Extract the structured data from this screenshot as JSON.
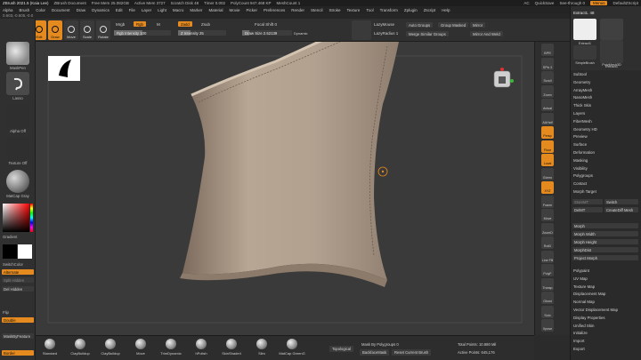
{
  "titlebar": {
    "title": "ZBrush 2021.5 (Kaia Lee)",
    "doc": "ZBrush Document",
    "free_mem": "Free Mem 25.082GB",
    "active_mem": "Active Mem 3727",
    "scratch": "Scratch Disk 48",
    "timer": "Timer 0.002",
    "polycount": "PolyCount 947.468 KP",
    "meshcount": "MeshCount 1",
    "right": [
      "AC",
      "QuickSave",
      "See-through 0",
      "Menus",
      "DefaultZScript"
    ]
  },
  "menubar": [
    "Alpha",
    "Brush",
    "Color",
    "Document",
    "Draw",
    "Dynamics",
    "Edit",
    "File",
    "Layer",
    "Light",
    "Macro",
    "Marker",
    "Material",
    "Movie",
    "Picker",
    "Preferences",
    "Render",
    "Stencil",
    "Stroke",
    "Texture",
    "Tool",
    "Transform",
    "Zplugin",
    "Zscript",
    "Help"
  ],
  "status": "0.603,-0.605,-0.0",
  "topshelf": {
    "lightbox": "LightBox",
    "tools": [
      {
        "label": "Edit",
        "active": true
      },
      {
        "label": "Draw",
        "active": true
      },
      {
        "label": "Move",
        "active": false
      },
      {
        "label": "Scale",
        "active": false
      },
      {
        "label": "Rotate",
        "active": false
      }
    ],
    "mrgb": "Mrgb",
    "rgb": "Rgb",
    "m": "M",
    "rgb_intensity": "Rgb Intensity 100",
    "zadd": "Zadd",
    "zsub": "Zsub",
    "z_intensity": "Z Intensity 25",
    "focal_shift": "Focal Shift 0",
    "draw_size": "Draw Size 2.52139",
    "dynamic": "Dynamic",
    "lazymouse": "LazyMouse",
    "lazyradius": "LazyRadius 1",
    "auto_groups": "Auto Groups",
    "group_masked": "Group Masked",
    "mirror": "Mirror",
    "merge_similar": "Merge Similar Groups",
    "mirror_weld": "Mirror And Weld",
    "rgb_pct": 0.5,
    "z_pct": 0.25,
    "draw_pct": 0.15
  },
  "leftpanel": {
    "brush": "MaskPen",
    "stroke": "Lasso",
    "alpha": "Alpha Off",
    "texture": "Texture Off",
    "material": "MatCap Gray",
    "gradient": "Gradient",
    "switch": "SwitchColor",
    "alternate": "Alternate",
    "split_hidden": "Split Hidden",
    "del_hidden": "Del Hidden",
    "flip": "Flip",
    "double": "Double",
    "mask_by_feature": "MaskByFeature",
    "border": "Border"
  },
  "rightdock": [
    "BPR",
    "SPix 3",
    "Scroll",
    "Zoom",
    "Actual",
    "AAHalf",
    "Persp",
    "Floor",
    "Local",
    "Gizmo",
    "XYZ",
    "Frame",
    "Move",
    "ZoomD",
    "RotD",
    "Line Fill",
    "PolyF",
    "Transp",
    "Ghost",
    "Solo",
    "Xpose"
  ],
  "toolpanel": {
    "header": "Extract1. 48",
    "thumbs": [
      "Extract1",
      "Cylinder3D",
      "PolyMesh3D",
      "SimpleBrush",
      "Extract1"
    ],
    "items_a": [
      "Subtool",
      "Geometry",
      "ArrayMesh",
      "NanoMesh",
      "Thick Skin",
      "Layers",
      "FiberMesh",
      "Geometry HD",
      "Preview",
      "Surface",
      "Deformation",
      "Masking",
      "Visibility",
      "Polygroups",
      "Contact",
      "Morph Target"
    ],
    "storemt": "StoreMT",
    "switch": "Switch",
    "delmt": "DelMT",
    "createdif": "CreateDiff Mesh",
    "morph": "Morph",
    "morph_width": "Morph Width",
    "morph_height": "Morph Height",
    "morph_dist": "MorphDist",
    "project_morph": "Project Morph",
    "items_b": [
      "Polypaint",
      "UV Map",
      "Texture Map",
      "Displacement Map",
      "Normal Map",
      "Vector Displacement Map",
      "Display Properties",
      "Unified Skin",
      "Initialize",
      "Import",
      "Export"
    ]
  },
  "bottomshelf": {
    "brushes": [
      "Standard",
      "ClayBuildup",
      "ClayBuildup",
      "Move",
      "TrimDynamic",
      "hPolish",
      "SkinShade4",
      "Slim",
      "MatCap GreenG"
    ],
    "topological": "Topological",
    "mask_by_poly": "Mask By Polygroups 0",
    "backface": "BackfaceMask",
    "reset_brush": "Reset Current Brush",
    "total_points": "Total Points: 10.880 Mil",
    "active_points": "Active Points: 645,176"
  },
  "colors": {
    "accent": "#e58a1f",
    "mesh": "#b5a391",
    "bg": "#3a3a3a"
  }
}
